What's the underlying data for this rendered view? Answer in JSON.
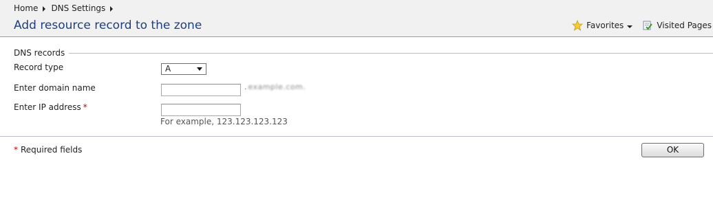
{
  "breadcrumb": {
    "items": [
      "Home",
      "DNS Settings"
    ]
  },
  "page_title": "Add resource record to the zone",
  "toolbar": {
    "favorites_label": "Favorites",
    "favorites_icon": "star-icon",
    "visited_label": "Visited Pages",
    "visited_icon": "visited-pages-icon"
  },
  "form": {
    "section_title": "DNS records",
    "record_type_label": "Record type",
    "record_type_value": "A",
    "domain_label": "Enter domain name",
    "domain_value": "",
    "domain_suffix_dot": ".",
    "domain_suffix_blurred": "example.com.",
    "ip_label": "Enter IP address",
    "ip_value": "",
    "ip_hint": "For example, 123.123.123.123",
    "required_marker": "*",
    "required_note": "Required fields"
  },
  "buttons": {
    "ok_label": "OK"
  },
  "colors": {
    "title": "#1d3f7f",
    "required": "#c00000",
    "divider": "#b9bcd0",
    "header_bg": "#f1f1f1"
  }
}
